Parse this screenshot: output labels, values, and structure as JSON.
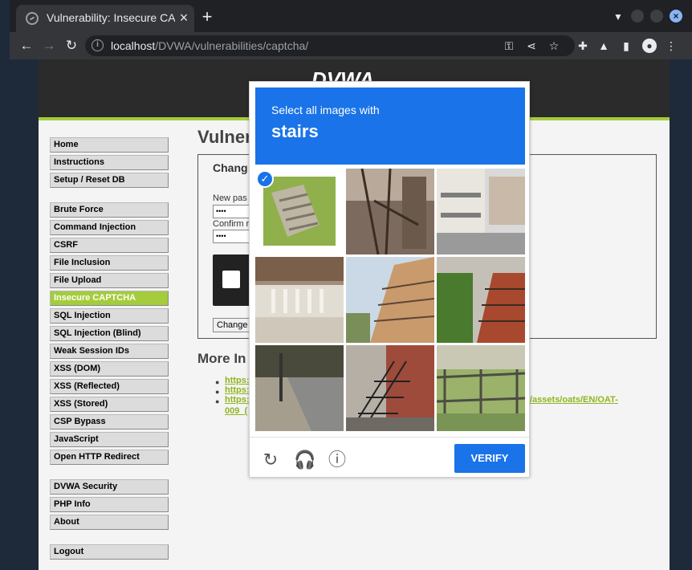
{
  "browser": {
    "tab_title": "Vulnerability: Insecure CAPTCHA",
    "tab_close": "×",
    "new_tab": "+",
    "url_host": "localhost",
    "url_path": "/DVWA/vulnerabilities/captcha/",
    "icons": [
      "key-icon",
      "share-icon",
      "star-icon",
      "extensions-icon",
      "labs-icon",
      "sidepanel-icon",
      "profile-icon",
      "menu-icon"
    ]
  },
  "sidebar": {
    "groups": [
      [
        "Home",
        "Instructions",
        "Setup / Reset DB"
      ],
      [
        "Brute Force",
        "Command Injection",
        "CSRF",
        "File Inclusion",
        "File Upload",
        "Insecure CAPTCHA",
        "SQL Injection",
        "SQL Injection (Blind)",
        "Weak Session IDs",
        "XSS (DOM)",
        "XSS (Reflected)",
        "XSS (Stored)",
        "CSP Bypass",
        "JavaScript",
        "Open HTTP Redirect"
      ],
      [
        "DVWA Security",
        "PHP Info",
        "About"
      ],
      [
        "Logout"
      ]
    ],
    "active": "Insecure CAPTCHA",
    "accent": "#a4cc3c"
  },
  "main": {
    "title": "Vulner",
    "box_title": "Chang",
    "new_password_label": "New pas",
    "new_password_value": "••••",
    "confirm_label": "Confirm r",
    "confirm_value": "••••",
    "change_button": "Change",
    "more_title": "More In",
    "links": [
      "https:",
      "https:",
      "https:",
      "009_(",
      "/assets/oats/EN/OAT-"
    ]
  },
  "captcha": {
    "instruction": "Select all images with",
    "target": "stairs",
    "verify_label": "VERIFY",
    "header_color": "#1a73e8",
    "selected_tile": 0
  }
}
